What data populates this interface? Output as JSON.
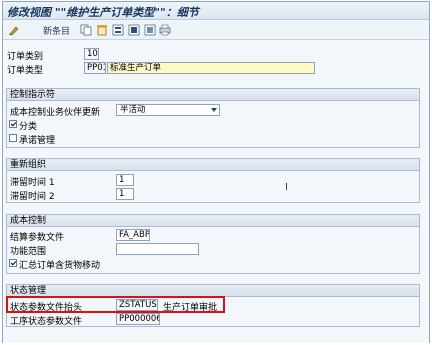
{
  "window": {
    "title": "修改视图 \"\"维护生产订单类型\"\"：细节"
  },
  "toolbar": {
    "new_entries_label": "新条目"
  },
  "header": {
    "order_category_label": "订单类别",
    "order_category_value": "10",
    "order_type_label": "订单类型",
    "order_type_code": "PP01",
    "order_type_text": "标准生产订单"
  },
  "control": {
    "title": "控制指示符",
    "cost_collector_label": "成本控制业务伙伴更新",
    "cost_collector_value": "半活动",
    "classification_label": "分类",
    "classification_checked": true,
    "commitment_label": "承诺管理",
    "commitment_checked": false
  },
  "reorg": {
    "title": "重新组织",
    "residence1_label": "滞留时间 1",
    "residence1_value": "1",
    "residence2_label": "滞留时间 2",
    "residence2_value": "1"
  },
  "costing": {
    "title": "成本控制",
    "settlement_label": "结算参数文件",
    "settlement_value": "FA_ABP",
    "functional_area_label": "功能范围",
    "functional_area_value": "",
    "collective_label": "汇总订单含货物移动",
    "collective_checked": true
  },
  "status": {
    "title": "状态管理",
    "header_profile_label": "状态参数文件抬头",
    "header_profile_value": "ZSTATUS",
    "header_profile_text": "生产订单审批",
    "op_profile_label": "工序状态参数文件",
    "op_profile_value": "PP000006"
  },
  "colors": {
    "highlight": "#e01010",
    "accent": "#16365c"
  }
}
